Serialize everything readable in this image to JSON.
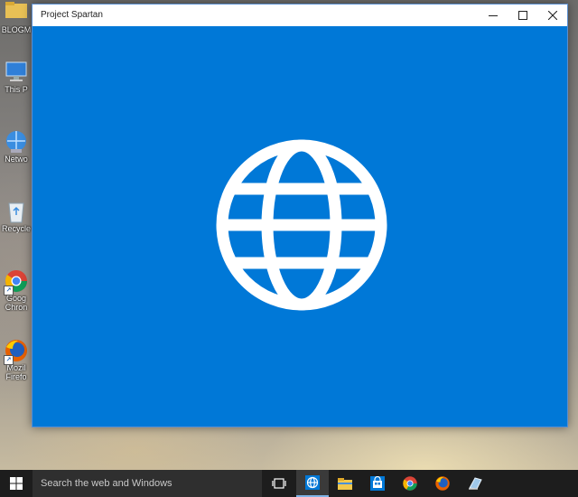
{
  "window": {
    "title": "Project Spartan",
    "minimize_icon": "minimize-icon",
    "maximize_icon": "maximize-icon",
    "close_icon": "close-icon",
    "splash_icon": "globe-icon",
    "background_color": "#0078d7"
  },
  "desktop": {
    "icons": [
      {
        "label": "BLOGM",
        "icon": "folder-icon"
      },
      {
        "label": "This P",
        "icon": "computer-icon"
      },
      {
        "label": "Netwo",
        "icon": "network-icon"
      },
      {
        "label": "Recycle",
        "icon": "recycle-bin-icon"
      },
      {
        "label": "Goog Chron",
        "icon": "chrome-icon"
      },
      {
        "label": "Mozil Firefo",
        "icon": "firefox-icon"
      }
    ]
  },
  "taskbar": {
    "search_placeholder": "Search the web and Windows",
    "items": [
      "windows-start-icon",
      "task-view-icon",
      "spartan-browser-icon",
      "file-explorer-icon",
      "store-icon",
      "chrome-icon",
      "firefox-icon",
      "misc-app-icon"
    ]
  }
}
